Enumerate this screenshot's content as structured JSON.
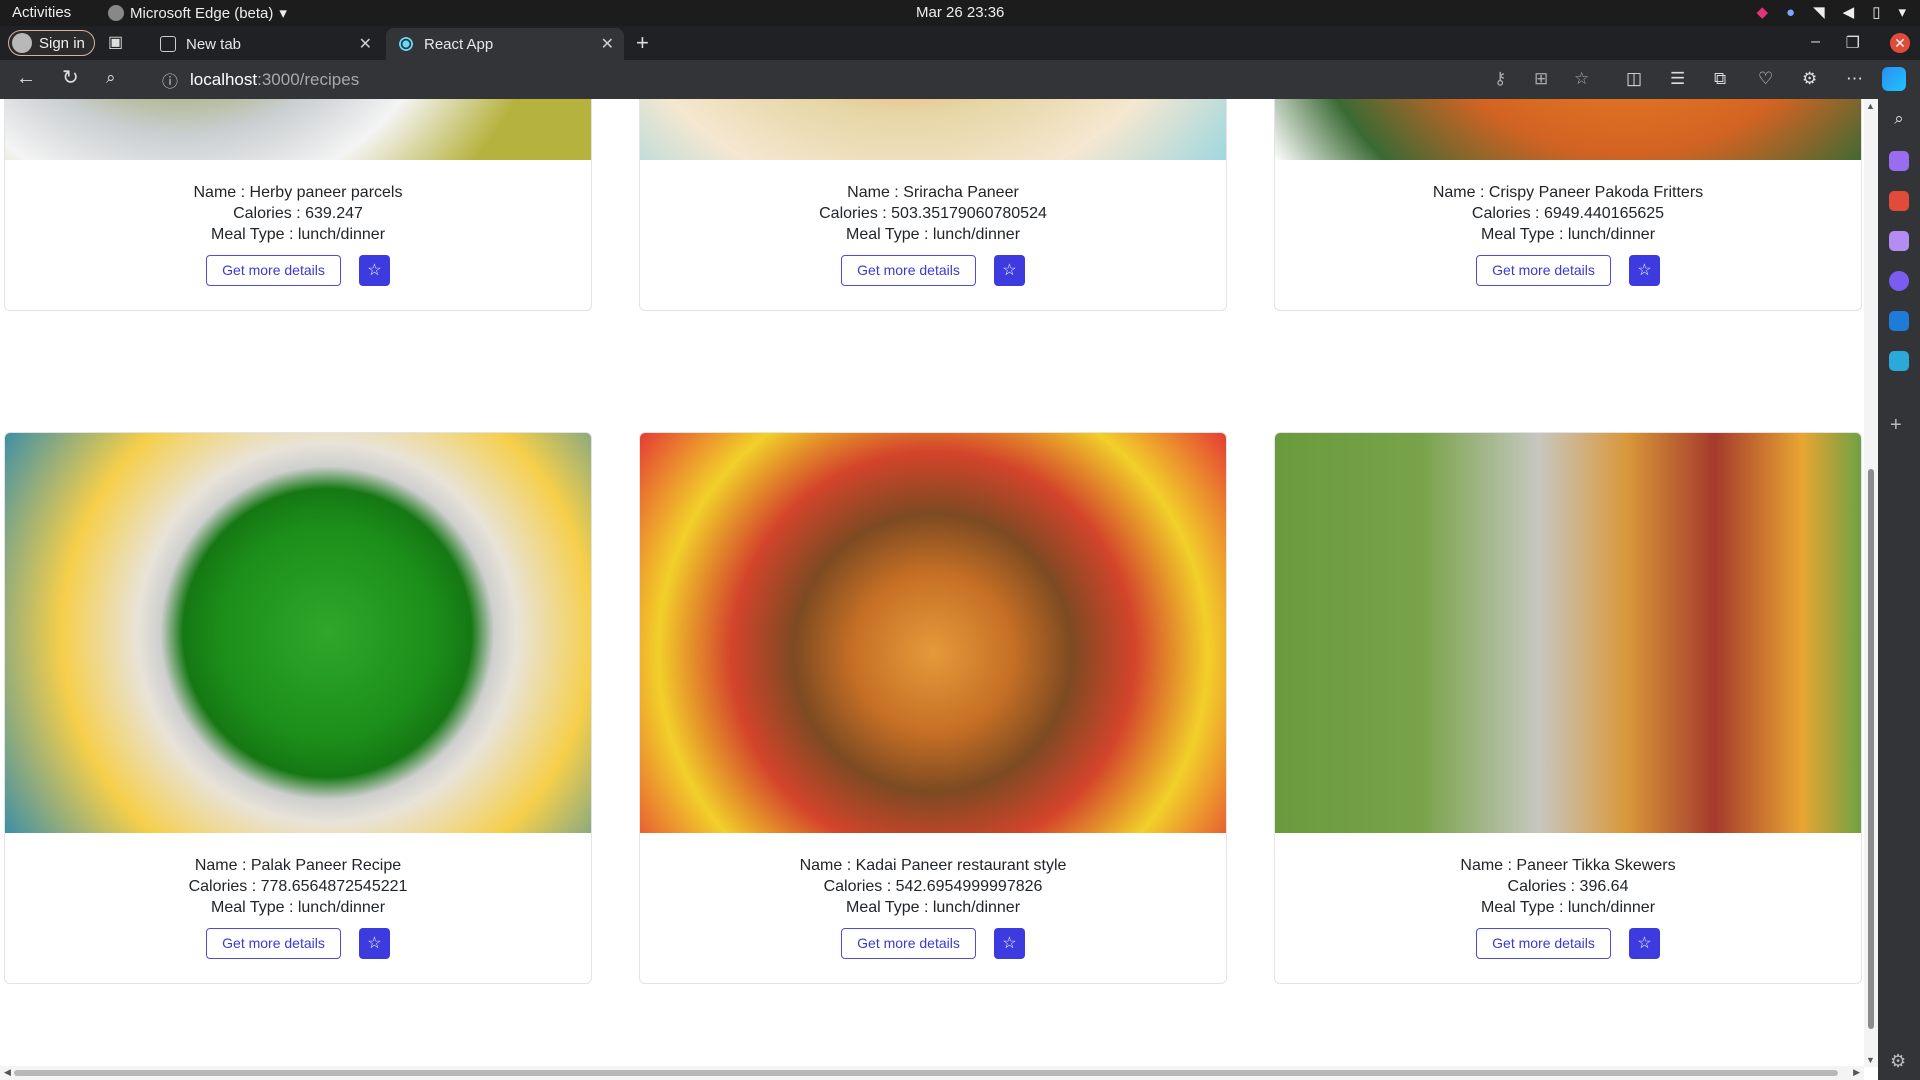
{
  "os": {
    "activities": "Activities",
    "app_name": "Microsoft Edge (beta)",
    "clock": "Mar 26  23:36"
  },
  "browser": {
    "signin_label": "Sign in",
    "tabs": [
      {
        "title": "New tab"
      },
      {
        "title": "React App"
      }
    ],
    "url_host": "localhost",
    "url_path": ":3000/recipes"
  },
  "recipes": {
    "details_label": "Get more details",
    "items": [
      {
        "name": "Name : Herby paneer parcels",
        "calories": "Calories : 639.247",
        "meal": "Meal Type : lunch/dinner"
      },
      {
        "name": "Name : Sriracha Paneer",
        "calories": "Calories : 503.35179060780524",
        "meal": "Meal Type : lunch/dinner"
      },
      {
        "name": "Name : Crispy Paneer Pakoda Fritters",
        "calories": "Calories : 6949.440165625",
        "meal": "Meal Type : lunch/dinner"
      },
      {
        "name": "Name : Palak Paneer Recipe",
        "calories": "Calories : 778.6564872545221",
        "meal": "Meal Type : lunch/dinner"
      },
      {
        "name": "Name : Kadai Paneer restaurant style",
        "calories": "Calories : 542.6954999997826",
        "meal": "Meal Type : lunch/dinner"
      },
      {
        "name": "Name : Paneer Tikka Skewers",
        "calories": "Calories : 396.64",
        "meal": "Meal Type : lunch/dinner"
      }
    ]
  },
  "colors": {
    "accent": "#3d3ae0",
    "close_button": "#e04b3a"
  }
}
